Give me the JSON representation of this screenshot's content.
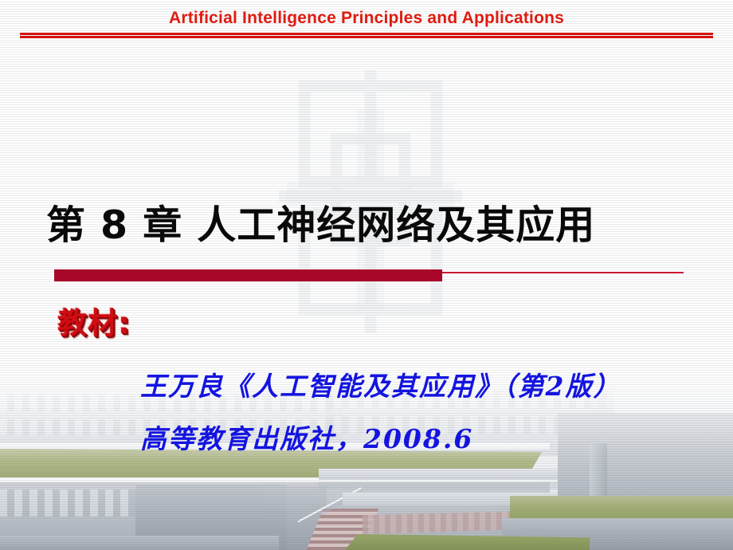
{
  "slide": {
    "header": {
      "title": "Artificial Intelligence Principles and Applications",
      "title_color": "#e01b10",
      "rule_color": "#d21410"
    },
    "chapter": {
      "title": "第 8 章  人工神经网络及其应用",
      "color": "#0a0a0a"
    },
    "divider": {
      "thick_color": "#a8062a",
      "thin_color": "#c81030"
    },
    "textbook": {
      "label": "教材:",
      "label_color": "#cf0d12",
      "references": [
        "王万良《人工智能及其应用》（第2版）",
        "高等教育出版社，2008.6"
      ],
      "reference_color": "#1414e0"
    },
    "background": {
      "description": "faded aerial photograph of a university campus building complex with green rooftops",
      "scanline_texture": true,
      "watermark": "emblem-watermark"
    }
  }
}
